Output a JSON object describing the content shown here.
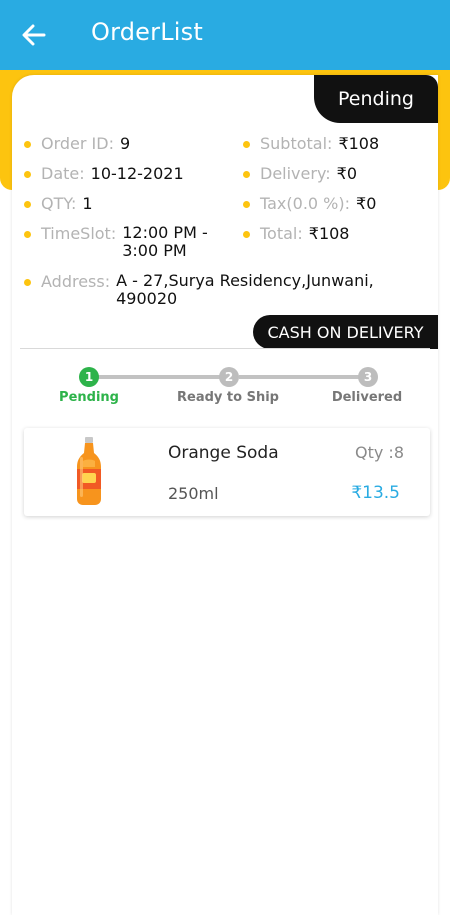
{
  "appbar": {
    "title": "OrderList",
    "back_icon": "arrow-left-icon",
    "color": "#29ABE2"
  },
  "order": {
    "status": "Pending",
    "payment_method": "CASH ON DELIVERY",
    "fields": {
      "order_id": {
        "label": "Order ID:",
        "value": "9"
      },
      "date": {
        "label": "Date:",
        "value": "10-12-2021"
      },
      "qty": {
        "label": "QTY:",
        "value": "1"
      },
      "timeslot": {
        "label": "TimeSlot:",
        "value_line1": "12:00 PM -",
        "value_line2": "3:00 PM"
      },
      "address": {
        "label": "Address:",
        "value_line1": "A - 27,Surya Residency,Junwani,",
        "value_line2": "490020"
      },
      "subtotal": {
        "label": "Subtotal:",
        "value": "₹108"
      },
      "delivery": {
        "label": "Delivery:",
        "value": "₹0"
      },
      "tax": {
        "label": "Tax(0.0 %):",
        "value": "₹0"
      },
      "total": {
        "label": "Total:",
        "value": "₹108"
      }
    }
  },
  "stepper": {
    "current_step": 1,
    "steps": [
      {
        "number": "1",
        "label": "Pending"
      },
      {
        "number": "2",
        "label": "Ready to Ship"
      },
      {
        "number": "3",
        "label": "Delivered"
      }
    ],
    "active_color": "#2DB34A",
    "inactive_color": "#BDBDBD"
  },
  "items": [
    {
      "name": "Orange Soda",
      "size": "250ml",
      "qty": "Qty :8",
      "price": "₹13.5",
      "image_icon": "orange-soda-bottle-icon"
    }
  ],
  "colors": {
    "accent_yellow": "#FDC40F",
    "price_blue": "#29ABE2"
  }
}
